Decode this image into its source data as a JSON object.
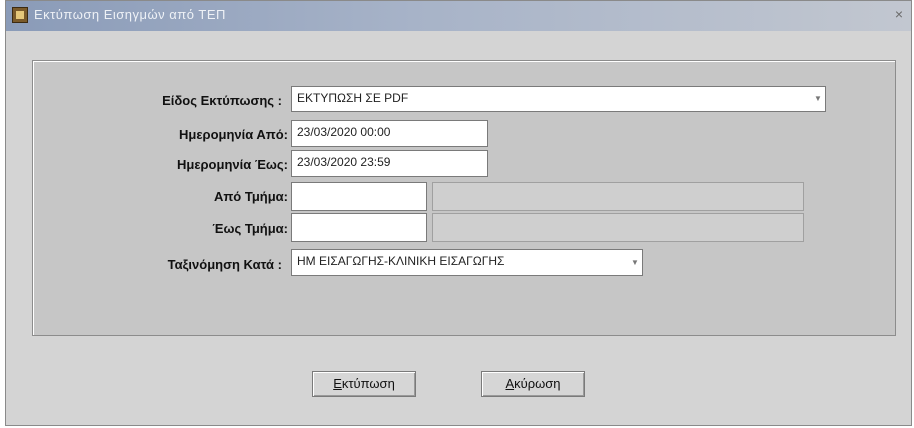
{
  "window": {
    "title": "Εκτύπωση Εισηγμών από ΤΕΠ",
    "close_glyph": "×"
  },
  "form": {
    "print_type": {
      "label": "Είδος Εκτύπωσης :",
      "value": "ΕΚΤΥΠΩΣΗ ΣΕ PDF"
    },
    "date_from": {
      "label": "Ημερομηνία Από:",
      "value": "23/03/2020 00:00"
    },
    "date_to": {
      "label": "Ημερομηνία Έως:",
      "value": "23/03/2020 23:59"
    },
    "dept_from": {
      "label": "Από Τμήμα:",
      "code": "",
      "name": ""
    },
    "dept_to": {
      "label": "Έως Τμήμα:",
      "code": "",
      "name": ""
    },
    "sort_by": {
      "label": "Ταξινόμηση Κατά :",
      "value": "ΗΜ ΕΙΣΑΓΩΓΗΣ-ΚΛΙΝΙΚΗ ΕΙΣΑΓΩΓΗΣ"
    }
  },
  "buttons": {
    "print": {
      "mnemonic": "Ε",
      "rest": "κτύπωση"
    },
    "cancel": {
      "mnemonic": "Α",
      "rest": "κύρωση"
    }
  },
  "colors": {
    "window_bg": "#d4d4d4",
    "panel_bg": "#c6c6c6",
    "title_gradient_start": "#8a9bb8"
  }
}
